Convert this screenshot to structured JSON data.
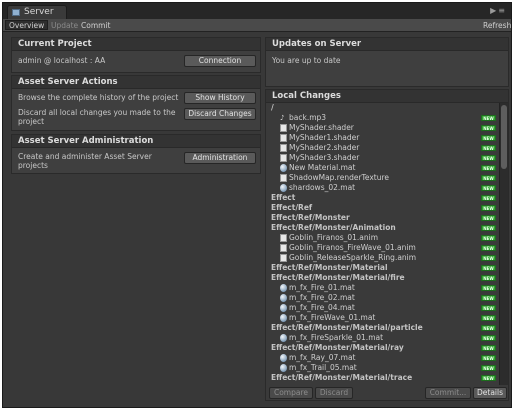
{
  "window": {
    "tab_label": "Server",
    "tab_icon": "server-icon"
  },
  "toolbar": {
    "overview": "Overview",
    "update": "Update",
    "commit": "Commit",
    "refresh": "Refresh"
  },
  "current_project": {
    "heading": "Current Project",
    "connection_text": "admin @ localhost : AA",
    "connection_button": "Connection"
  },
  "asset_server_actions": {
    "heading": "Asset Server Actions",
    "history_text": "Browse the complete history of the project",
    "history_button": "Show History",
    "discard_text": "Discard all local changes you made to the project",
    "discard_button": "Discard Changes"
  },
  "asset_server_admin": {
    "heading": "Asset Server Administration",
    "admin_text": "Create and administer Asset Server projects",
    "admin_button": "Administration"
  },
  "updates_on_server": {
    "heading": "Updates on Server",
    "status": "You are up to date"
  },
  "local_changes": {
    "heading": "Local Changes",
    "badge_label": "NEW",
    "items": [
      {
        "label": "/",
        "kind": "folder",
        "indent": 0,
        "badge": false
      },
      {
        "label": "back.mp3",
        "kind": "audio",
        "indent": 1,
        "badge": true
      },
      {
        "label": "MyShader.shader",
        "kind": "file",
        "indent": 1,
        "badge": true
      },
      {
        "label": "MyShader1.shader",
        "kind": "file",
        "indent": 1,
        "badge": true
      },
      {
        "label": "MyShader2.shader",
        "kind": "file",
        "indent": 1,
        "badge": true
      },
      {
        "label": "MyShader3.shader",
        "kind": "file",
        "indent": 1,
        "badge": true
      },
      {
        "label": "New Material.mat",
        "kind": "sphere",
        "indent": 1,
        "badge": true
      },
      {
        "label": "ShadowMap.renderTexture",
        "kind": "file",
        "indent": 1,
        "badge": true
      },
      {
        "label": "shardows_02.mat",
        "kind": "sphere",
        "indent": 1,
        "badge": true
      },
      {
        "label": "Effect",
        "kind": "folder",
        "indent": 0,
        "badge": true
      },
      {
        "label": "Effect/Ref",
        "kind": "folder",
        "indent": 0,
        "badge": true
      },
      {
        "label": "Effect/Ref/Monster",
        "kind": "folder",
        "indent": 0,
        "badge": true
      },
      {
        "label": "Effect/Ref/Monster/Animation",
        "kind": "folder",
        "indent": 0,
        "badge": true
      },
      {
        "label": "Goblin_Firanos_01.anim",
        "kind": "file",
        "indent": 1,
        "badge": true
      },
      {
        "label": "Goblin_Firanos_FireWave_01.anim",
        "kind": "file",
        "indent": 1,
        "badge": true
      },
      {
        "label": "Goblin_ReleaseSparkle_Ring.anim",
        "kind": "file",
        "indent": 1,
        "badge": true
      },
      {
        "label": "Effect/Ref/Monster/Material",
        "kind": "folder",
        "indent": 0,
        "badge": true
      },
      {
        "label": "Effect/Ref/Monster/Material/fire",
        "kind": "folder",
        "indent": 0,
        "badge": true
      },
      {
        "label": "m_fx_Fire_01.mat",
        "kind": "sphere",
        "indent": 1,
        "badge": true
      },
      {
        "label": "m_fx_Fire_02.mat",
        "kind": "sphere",
        "indent": 1,
        "badge": true
      },
      {
        "label": "m_fx_Fire_04.mat",
        "kind": "sphere",
        "indent": 1,
        "badge": true
      },
      {
        "label": "m_fx_FireWave_01.mat",
        "kind": "sphere",
        "indent": 1,
        "badge": true
      },
      {
        "label": "Effect/Ref/Monster/Material/particle",
        "kind": "folder",
        "indent": 0,
        "badge": true
      },
      {
        "label": "m_fx_FireSparkle_01.mat",
        "kind": "sphere",
        "indent": 1,
        "badge": true
      },
      {
        "label": "Effect/Ref/Monster/Material/ray",
        "kind": "folder",
        "indent": 0,
        "badge": true
      },
      {
        "label": "m_fx_Ray_07.mat",
        "kind": "sphere",
        "indent": 1,
        "badge": true
      },
      {
        "label": "m_fx_Trail_05.mat",
        "kind": "sphere",
        "indent": 1,
        "badge": true
      },
      {
        "label": "Effect/Ref/Monster/Material/trace",
        "kind": "folder",
        "indent": 0,
        "badge": true
      }
    ]
  },
  "footer": {
    "compare": "Compare",
    "discard": "Discard",
    "commit": "Commit...",
    "details": "Details"
  }
}
